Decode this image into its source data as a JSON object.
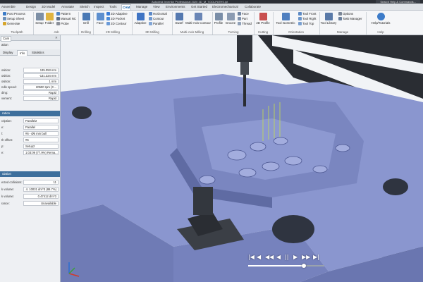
{
  "window": {
    "title": "Autodesk Inventor Professional 2020   3D_M_TOOLPATHS.ipt",
    "help_search": "Search Help & Commands..."
  },
  "tabs": [
    "Assemble",
    "Design",
    "3D Model",
    "Annotate",
    "Sketch",
    "Inspect",
    "Tools",
    "CAM",
    "Manage",
    "View",
    "Environments",
    "Get Started",
    "Electromechanical",
    "Collaborate"
  ],
  "active_tab": "CAM",
  "ribbon": {
    "toolpath": {
      "items": [
        "Post Process",
        "Setup Sheet",
        "Generate"
      ],
      "group": "Toolpath"
    },
    "job": {
      "items": [
        "Setup",
        "Folder",
        "Pattern",
        "Manual NC",
        "Probe"
      ],
      "group": "Job"
    },
    "drilling": {
      "items": [
        "Drill"
      ],
      "group": "Drilling"
    },
    "milling2d": {
      "big": "Face",
      "items": [
        "2D Adaptive",
        "2D Pocket",
        "2D Contour"
      ],
      "group": "2D Milling"
    },
    "milling3d": {
      "big": "Adaptive",
      "items": [
        "Horizontal",
        "Contour",
        "Parallel"
      ],
      "group": "3D Milling"
    },
    "multiaxis": {
      "items": [
        "Swarf",
        "Multi-Axis Contour"
      ],
      "group": "Multi-Axis Milling"
    },
    "turning": {
      "items": [
        "Profile",
        "Groove",
        "Face",
        "Part",
        "Thread"
      ],
      "group": "Turning"
    },
    "cutting": {
      "items": [
        "2D Profile"
      ],
      "group": "Cutting"
    },
    "orientation": {
      "big": "Tool Isometric",
      "items": [
        "Tool Front",
        "Tool Right",
        "Tool Top"
      ],
      "group": "Orientation"
    },
    "manage": {
      "items": [
        "Tool Library",
        "Options",
        "Task Manager"
      ],
      "group": "Manage"
    },
    "help": {
      "items": [
        "Help/Tutorials"
      ],
      "group": "Help"
    }
  },
  "panel": {
    "header": "Cam",
    "subheader": "ation",
    "tabs": [
      "Display",
      "Info",
      "Statistics"
    ],
    "active_tab": "Info",
    "rows1": [
      {
        "label": "osition:",
        "value": "135.053 mm"
      },
      {
        "label": "osition:",
        "value": "-131.324 mm"
      },
      {
        "label": "osition:",
        "value": "1 mm"
      },
      {
        "label": "ndle speed:",
        "value": "20500 rpm (C..."
      },
      {
        "label": "ding:",
        "value": "Rapid"
      },
      {
        "label": "vement:",
        "value": "Rapid"
      }
    ],
    "section2": "ration",
    "rows2": [
      {
        "label": "cription:",
        "value": "Parallel2"
      },
      {
        "label": "e:",
        "value": "Parallel"
      },
      {
        "label": "l:",
        "value": "#6 - Ø6 mm ball"
      },
      {
        "label": "th offset:",
        "value": "#6"
      },
      {
        "label": "p:",
        "value": "Setup2"
      },
      {
        "label": "e:",
        "value": "1:03:09 (77.9%) Rema..."
      }
    ],
    "section3": "ulation",
    "rows3": [
      {
        "label": "ected collisions:",
        "value": "11"
      },
      {
        "label": "k volume:",
        "value": "4. 10031 dm^3 (86.7%)"
      },
      {
        "label": "k volume:",
        "value": "0.47412 dm^3"
      },
      {
        "label": "rance:",
        "value": "Unavailable"
      }
    ]
  },
  "player": {
    "buttons": [
      "|◀",
      "◀",
      "◀◀",
      "◀",
      "||",
      "▶",
      "▶▶",
      "▶|"
    ],
    "progress": 0.73
  },
  "colors": {
    "accent": "#0b5ca8",
    "part": "#8a96cf",
    "section": "#3d6f9c"
  }
}
